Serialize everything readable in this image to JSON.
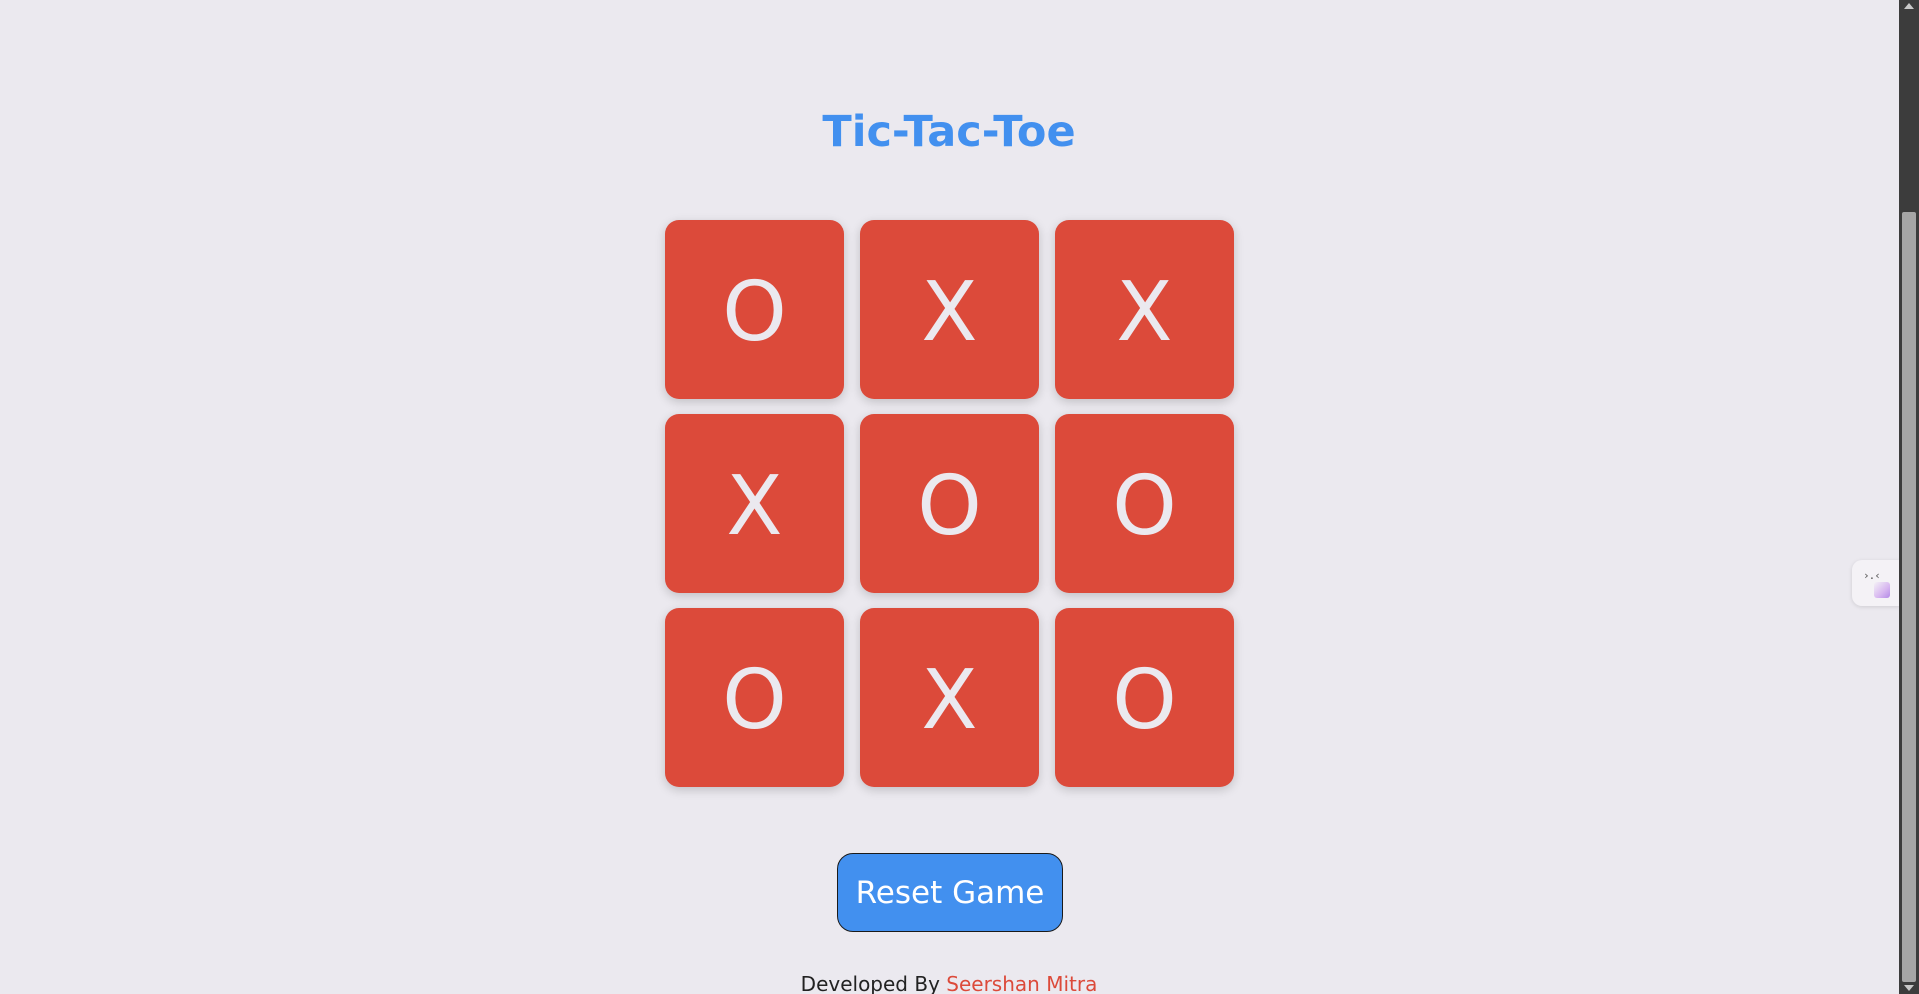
{
  "page": {
    "title": "Tic-Tac-Toe"
  },
  "board": {
    "cells": [
      "O",
      "X",
      "X",
      "X",
      "O",
      "O",
      "O",
      "X",
      "O"
    ],
    "cell_color": "#dc4a3a",
    "mark_color": "#ebe9ef"
  },
  "controls": {
    "reset_label": "Reset Game",
    "reset_color": "#4290ef"
  },
  "footer": {
    "prefix": "Developed By",
    "author": "Seershan Mitra"
  },
  "side_widget": {
    "icon": "extension-widget-icon",
    "glyph": "›.‹"
  },
  "colors": {
    "background": "#ebe9ef",
    "title": "#4290ef",
    "author": "#dc4a3a"
  }
}
